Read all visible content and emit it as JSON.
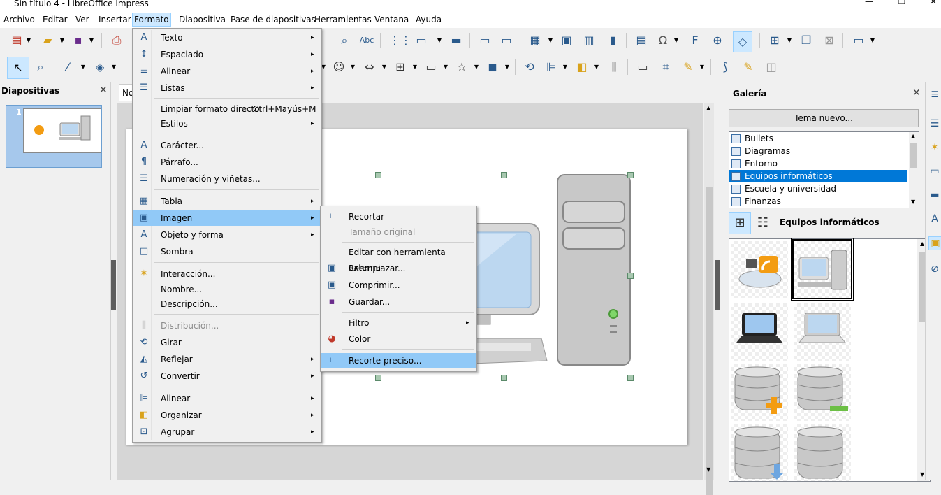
{
  "window": {
    "title": "Sin título 4 - LibreOffice Impress",
    "controls": [
      "—",
      "❐",
      "✕"
    ]
  },
  "menubar": {
    "items": [
      "Archivo",
      "Editar",
      "Ver",
      "Insertar",
      "Formato",
      "Diapositiva",
      "Pase de diapositivas",
      "Herramientas",
      "Ventana",
      "Ayuda"
    ],
    "active": "Formato"
  },
  "slides_pane": {
    "title": "Diapositivas",
    "close": "✕",
    "slide_number": "1"
  },
  "doc_tab": "No",
  "format_menu": {
    "items": [
      {
        "label": "Texto",
        "icon": "text-icon",
        "glyph": "A",
        "submenu": true
      },
      {
        "label": "Espaciado",
        "icon": "spacing-icon",
        "glyph": "↕",
        "submenu": true
      },
      {
        "label": "Alinear",
        "icon": "align-text-icon",
        "glyph": "≡",
        "submenu": true
      },
      {
        "label": "Listas",
        "icon": "list-icon",
        "glyph": "☰",
        "submenu": true
      },
      {
        "label": "Limpiar formato directo",
        "shortcut": "Ctrl+Mayús+M",
        "icon": "",
        "glyph": ""
      },
      {
        "label": "Estilos",
        "icon": "",
        "glyph": "",
        "submenu": true
      },
      {
        "label": "Carácter...",
        "icon": "character-icon",
        "glyph": "A"
      },
      {
        "label": "Párrafo...",
        "icon": "paragraph-icon",
        "glyph": "¶"
      },
      {
        "label": "Numeración y viñetas...",
        "icon": "bullets-icon",
        "glyph": "☰"
      },
      {
        "label": "Tabla",
        "icon": "table-icon",
        "glyph": "▦",
        "submenu": true
      },
      {
        "label": "Imagen",
        "icon": "image-icon",
        "glyph": "▣",
        "submenu": true,
        "highlighted": true
      },
      {
        "label": "Objeto y forma",
        "icon": "object-shape-icon",
        "glyph": "A",
        "submenu": true
      },
      {
        "label": "Sombra",
        "icon": "shadow-icon",
        "glyph": "□"
      },
      {
        "label": "Interacción...",
        "icon": "interaction-icon",
        "glyph": "✶"
      },
      {
        "label": "Nombre...",
        "icon": "",
        "glyph": ""
      },
      {
        "label": "Descripción...",
        "icon": "",
        "glyph": ""
      },
      {
        "label": "Distribución...",
        "icon": "distribution-icon",
        "glyph": "⫼",
        "disabled": true
      },
      {
        "label": "Girar",
        "icon": "rotate-icon",
        "glyph": "⟲"
      },
      {
        "label": "Reflejar",
        "icon": "flip-icon",
        "glyph": "◭",
        "submenu": true
      },
      {
        "label": "Convertir",
        "icon": "convert-icon",
        "glyph": "↺",
        "submenu": true
      },
      {
        "label": "Alinear",
        "icon": "align-objects-icon",
        "glyph": "⊫",
        "submenu": true
      },
      {
        "label": "Organizar",
        "icon": "arrange-icon",
        "glyph": "◧",
        "submenu": true
      },
      {
        "label": "Agrupar",
        "icon": "group-icon",
        "glyph": "⊡",
        "submenu": true
      }
    ]
  },
  "image_submenu": {
    "items": [
      {
        "label": "Recortar",
        "icon": "crop-icon",
        "glyph": "⌗"
      },
      {
        "label": "Tamaño original",
        "disabled": true
      },
      {
        "label": "Editar con herramienta externa"
      },
      {
        "label": "Reemplazar...",
        "icon": "replace-image-icon",
        "glyph": "▣"
      },
      {
        "label": "Comprimir...",
        "icon": "compress-image-icon",
        "glyph": "▣"
      },
      {
        "label": "Guardar...",
        "icon": "save-icon",
        "glyph": "▪"
      },
      {
        "label": "Filtro",
        "submenu": true
      },
      {
        "label": "Color",
        "icon": "color-icon",
        "glyph": "◕"
      },
      {
        "label": "Recorte preciso...",
        "icon": "precise-crop-icon",
        "glyph": "⌗",
        "highlighted": true
      }
    ]
  },
  "gallery": {
    "title": "Galería",
    "close": "✕",
    "new_theme_button": "Tema nuevo...",
    "themes": [
      "Bullets",
      "Diagramas",
      "Entorno",
      "Equipos informáticos",
      "Escuela y universidad",
      "Finanzas"
    ],
    "selected_theme": "Equipos informáticos",
    "view_title": "Equipos informáticos"
  },
  "colors": {
    "menu_highlight": "#91c9f7",
    "selection_blue": "#0078d7",
    "toolbar_bg": "#f0f0f0"
  }
}
